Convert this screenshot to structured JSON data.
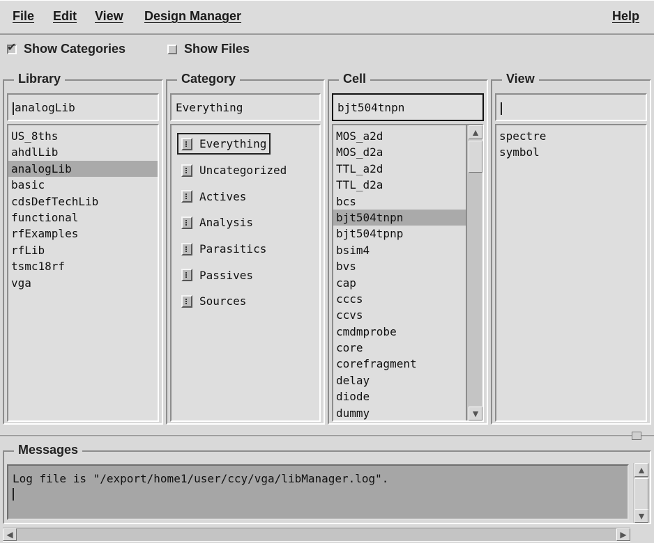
{
  "menubar": {
    "file": "File",
    "edit": "Edit",
    "view": "View",
    "design_manager": "Design Manager",
    "help": "Help"
  },
  "toggles": {
    "show_categories": {
      "label": "Show Categories",
      "checked": true
    },
    "show_files": {
      "label": "Show Files",
      "checked": false
    }
  },
  "library": {
    "title": "Library",
    "value": "analogLib",
    "items": [
      "US_8ths",
      "ahdlLib",
      "analogLib",
      "basic",
      "cdsDefTechLib",
      "functional",
      "rfExamples",
      "rfLib",
      "tsmc18rf",
      "vga"
    ],
    "selected": "analogLib"
  },
  "category": {
    "title": "Category",
    "value": "Everything",
    "items": [
      "Everything",
      "Uncategorized",
      "Actives",
      "Analysis",
      "Parasitics",
      "Passives",
      "Sources"
    ],
    "selected": "Everything"
  },
  "cell": {
    "title": "Cell",
    "value": "bjt504tnpn",
    "items": [
      "MOS_a2d",
      "MOS_d2a",
      "TTL_a2d",
      "TTL_d2a",
      "bcs",
      "bjt504tnpn",
      "bjt504tpnp",
      "bsim4",
      "bvs",
      "cap",
      "cccs",
      "ccvs",
      "cmdmprobe",
      "core",
      "corefragment",
      "delay",
      "diode",
      "dummy"
    ],
    "selected": "bjt504tnpn"
  },
  "view": {
    "title": "View",
    "value": "",
    "items": [
      "spectre",
      "symbol"
    ]
  },
  "messages": {
    "title": "Messages",
    "log": "Log file is \"/export/home1/user/ccy/vga/libManager.log\"."
  },
  "icons": {
    "check": "checkmark-icon",
    "category": "category-item-icon",
    "scroll_up": "arrow-up-icon",
    "scroll_down": "arrow-down-icon"
  }
}
